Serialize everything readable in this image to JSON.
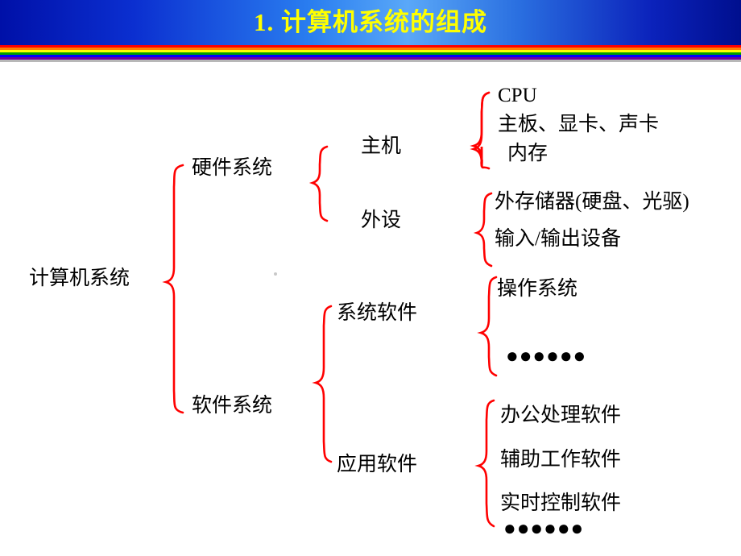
{
  "slide": {
    "title": "1. 计算机系统的组成",
    "title_color": "#ffff00",
    "brace_color": "#ff0000",
    "text_color": "#000000",
    "banner_colors": [
      "#0010a8",
      "#2a7ef0",
      "#5aa8f8",
      "#000f8e"
    ],
    "rainbow_stripes": [
      "#ff0000",
      "#ff8000",
      "#ffff00",
      "#00a000",
      "#0000ff",
      "#6a00a0"
    ]
  },
  "diagram": {
    "root": "计算机系统",
    "level1": {
      "hardware": "硬件系统",
      "software": "软件系统"
    },
    "level2": {
      "host": "主机",
      "peripheral": "外设",
      "system_software": "系统软件",
      "application_software": "应用软件"
    },
    "level3": {
      "host_items": [
        "CPU",
        "主板、显卡、声卡",
        "内存"
      ],
      "peripheral_items": [
        "外存储器(硬盘、光驱)",
        "输入/输出设备"
      ],
      "system_software_items": [
        "操作系统"
      ],
      "system_software_ellipsis": "●●●●●●",
      "application_software_items": [
        "办公处理软件",
        "辅助工作软件",
        "实时控制软件"
      ],
      "application_software_ellipsis": "●●●●●●"
    }
  }
}
